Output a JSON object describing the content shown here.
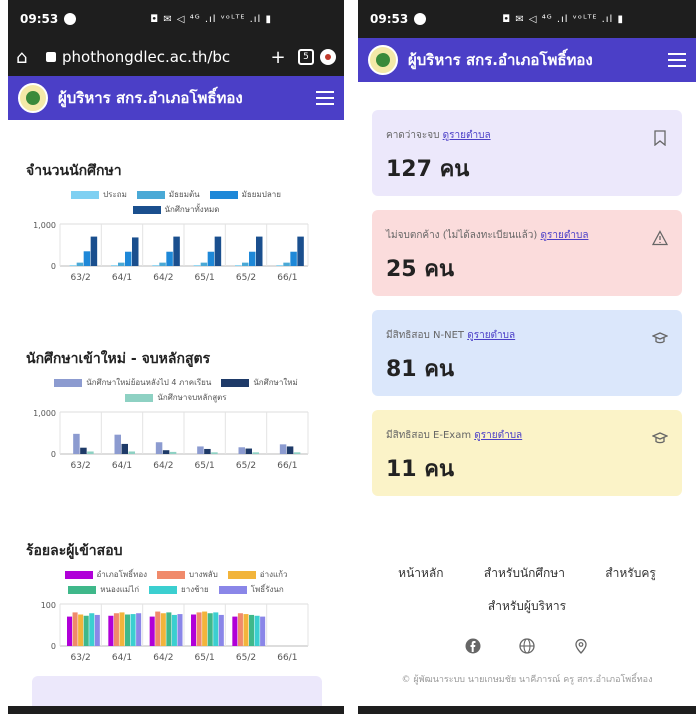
{
  "left": {
    "status": {
      "time": "09:53",
      "icons": "◘ ✉ ◁ ⁴ᴳ .ıl ᵛᵒᴸᵀᴱ .ıl ▮"
    },
    "url": {
      "text": "phothongdlec.ac.th/bc",
      "new_tab": "+",
      "tab_count": "5"
    },
    "appbar": {
      "title": "ผู้บริหาร สกร.อำเภอโพธิ์ทอง"
    },
    "charts": [
      {
        "title": "จำนวนนักศึกษา",
        "legend": [
          {
            "name": "ประถม",
            "color": "#7fd0f2"
          },
          {
            "name": "มัธยมต้น",
            "color": "#4aa9d6"
          },
          {
            "name": "มัธยมปลาย",
            "color": "#1e88d8"
          },
          {
            "name": "นักศึกษาทั้งหมด",
            "color": "#1a4f8e"
          }
        ],
        "ytick_top": "1,000",
        "ytick_zero": "0",
        "ymax": 1000,
        "categories": [
          "63/2",
          "64/1",
          "64/2",
          "65/1",
          "65/2",
          "66/1"
        ],
        "series": [
          [
            20,
            20,
            20,
            20,
            20,
            20
          ],
          [
            80,
            80,
            80,
            80,
            80,
            80
          ],
          [
            350,
            340,
            340,
            340,
            340,
            340
          ],
          [
            700,
            680,
            700,
            700,
            700,
            700
          ]
        ]
      },
      {
        "title": "นักศึกษาเข้าใหม่ - จบหลักสูตร",
        "legend": [
          {
            "name": "นักศึกษาใหม่ย้อนหลังไป 4 ภาคเรียน",
            "color": "#8c9bd0"
          },
          {
            "name": "นักศึกษาใหม่",
            "color": "#1e3a68"
          },
          {
            "name": "นักศึกษาจบหลักสูตร",
            "color": "#8ed1c3"
          }
        ],
        "ytick_top": "1,000",
        "ytick_zero": "0",
        "ymax": 1000,
        "categories": [
          "63/2",
          "64/1",
          "64/2",
          "65/1",
          "65/2",
          "66/1"
        ],
        "series": [
          [
            480,
            460,
            280,
            180,
            160,
            230
          ],
          [
            150,
            240,
            90,
            120,
            130,
            180
          ],
          [
            60,
            60,
            50,
            40,
            40,
            40
          ]
        ]
      },
      {
        "title": "ร้อยละผู้เข้าสอบ",
        "legend": [
          {
            "name": "อำเภอโพธิ์ทอง",
            "color": "#b000d8"
          },
          {
            "name": "บางพลับ",
            "color": "#f08a6b"
          },
          {
            "name": "อ่างแก้ว",
            "color": "#f2b43b"
          },
          {
            "name": "หนองแม่ไก่",
            "color": "#3fb88a"
          },
          {
            "name": "ยางช้าย",
            "color": "#3bcfd0"
          },
          {
            "name": "โพธิ์รังนก",
            "color": "#8a86e8"
          }
        ],
        "ytick_top": "100",
        "ytick_zero": "0",
        "ymax": 100,
        "categories": [
          "63/2",
          "64/1",
          "64/2",
          "65/1",
          "65/2",
          "66/1"
        ],
        "series": [
          [
            70,
            72,
            70,
            75,
            70,
            0
          ],
          [
            80,
            78,
            82,
            80,
            78,
            0
          ],
          [
            75,
            80,
            78,
            82,
            76,
            0
          ],
          [
            72,
            75,
            80,
            78,
            74,
            0
          ],
          [
            78,
            76,
            74,
            80,
            72,
            0
          ],
          [
            74,
            78,
            76,
            74,
            70,
            0
          ]
        ]
      }
    ]
  },
  "right": {
    "status": {
      "time": "09:53",
      "icons": "◘ ✉ ◁ ⁴ᴳ .ıl ᵛᵒᴸᵀᴱ .ıl ▮"
    },
    "appbar": {
      "title": "ผู้บริหาร สกร.อำเภอโพธิ์ทอง"
    },
    "cards": [
      {
        "label": "คาดว่าจะจบ",
        "link": "ดูรายตำบล",
        "value": "127 คน",
        "icon": "bookmark-icon",
        "bg": "#ece8fb"
      },
      {
        "label": "ไม่จบตกค้าง (ไม่ได้ลงทะเบียนแล้ว)",
        "link": "ดูรายตำบล",
        "value": "25 คน",
        "icon": "warning-icon",
        "bg": "#fbdcdc"
      },
      {
        "label": "มีสิทธิสอบ N-NET",
        "link": "ดูรายตำบล",
        "value": "81 คน",
        "icon": "graduation-cap-icon",
        "bg": "#dbe7fb"
      },
      {
        "label": "มีสิทธิสอบ E-Exam",
        "link": "ดูรายตำบล",
        "value": "11 คน",
        "icon": "graduation-cap-icon",
        "bg": "#fbf3c8"
      }
    ],
    "footer": {
      "nav": [
        "หน้าหลัก",
        "สำหรับนักศึกษา",
        "สำหรับครู"
      ],
      "nav2": "สำหรับผู้บริหาร",
      "icons": [
        "facebook-icon",
        "globe-icon",
        "location-icon"
      ],
      "copyright": "© ผู้พัฒนาระบบ นายเกษมชัย นาคีภารณ์ ครู สกร.อำเภอโพธิ์ทอง"
    }
  }
}
